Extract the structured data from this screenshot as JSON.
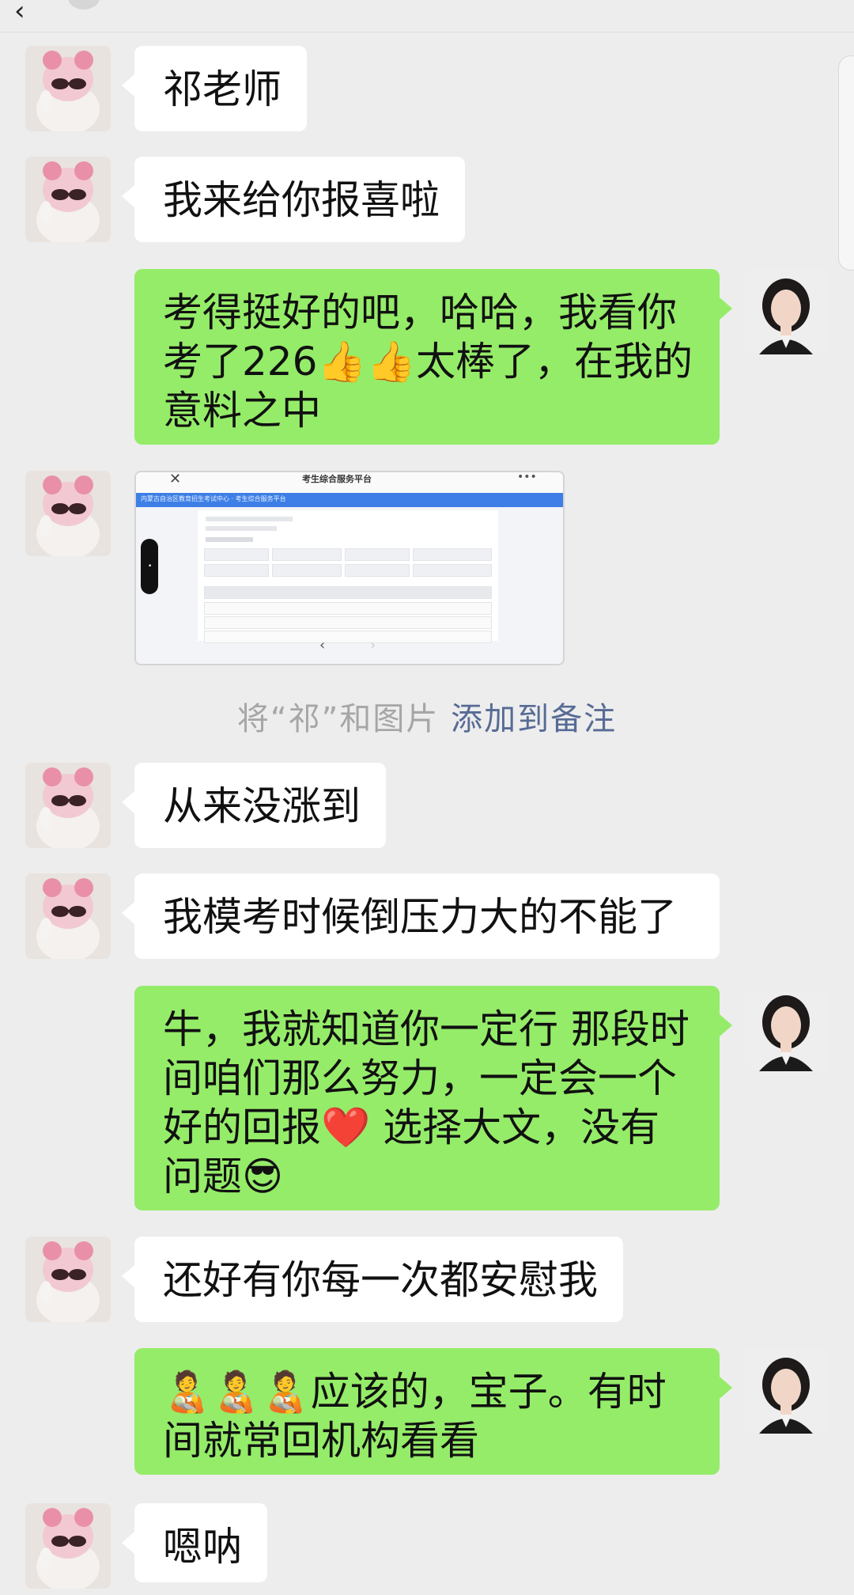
{
  "header": {
    "title": "",
    "back_icon": "chevron-left-icon"
  },
  "messages": [
    {
      "side": "left",
      "text": "祁老师"
    },
    {
      "side": "left",
      "text": "我来给你报喜啦"
    },
    {
      "side": "right",
      "text": "考得挺好的吧，哈哈，我看你考了226👍👍太棒了，在我的意料之中"
    },
    {
      "side": "left",
      "type": "image"
    },
    {
      "side": "left",
      "text": "从来没涨到"
    },
    {
      "side": "left",
      "text": "我模考时候倒压力大的不能了"
    },
    {
      "side": "right",
      "text": "牛，我就知道你一定行  那段时间咱们那么努力，一定会一个好的回报❤️  选择大文，没有问题😎"
    },
    {
      "side": "left",
      "text": "还好有你每一次都安慰我"
    },
    {
      "side": "right",
      "text": "🧑‍🍼🧑‍🍼🧑‍🍼应该的，宝子。有时间就常回机构看看"
    },
    {
      "side": "left",
      "text": "嗯呐"
    }
  ],
  "notice": {
    "prefix": "将“祁”和图片",
    "link": "添加到备注"
  },
  "image_message": {
    "title": "考生综合服务平台",
    "blue_bar": "内蒙古自治区教育招生考试中心 · 考生综合服务平台",
    "nav_prev": "‹",
    "nav_next": "›",
    "close": "✕",
    "more": "•••"
  },
  "colors": {
    "background": "#ededed",
    "incoming_bubble": "#ffffff",
    "outgoing_bubble": "#95ec69",
    "link": "#576b95"
  }
}
